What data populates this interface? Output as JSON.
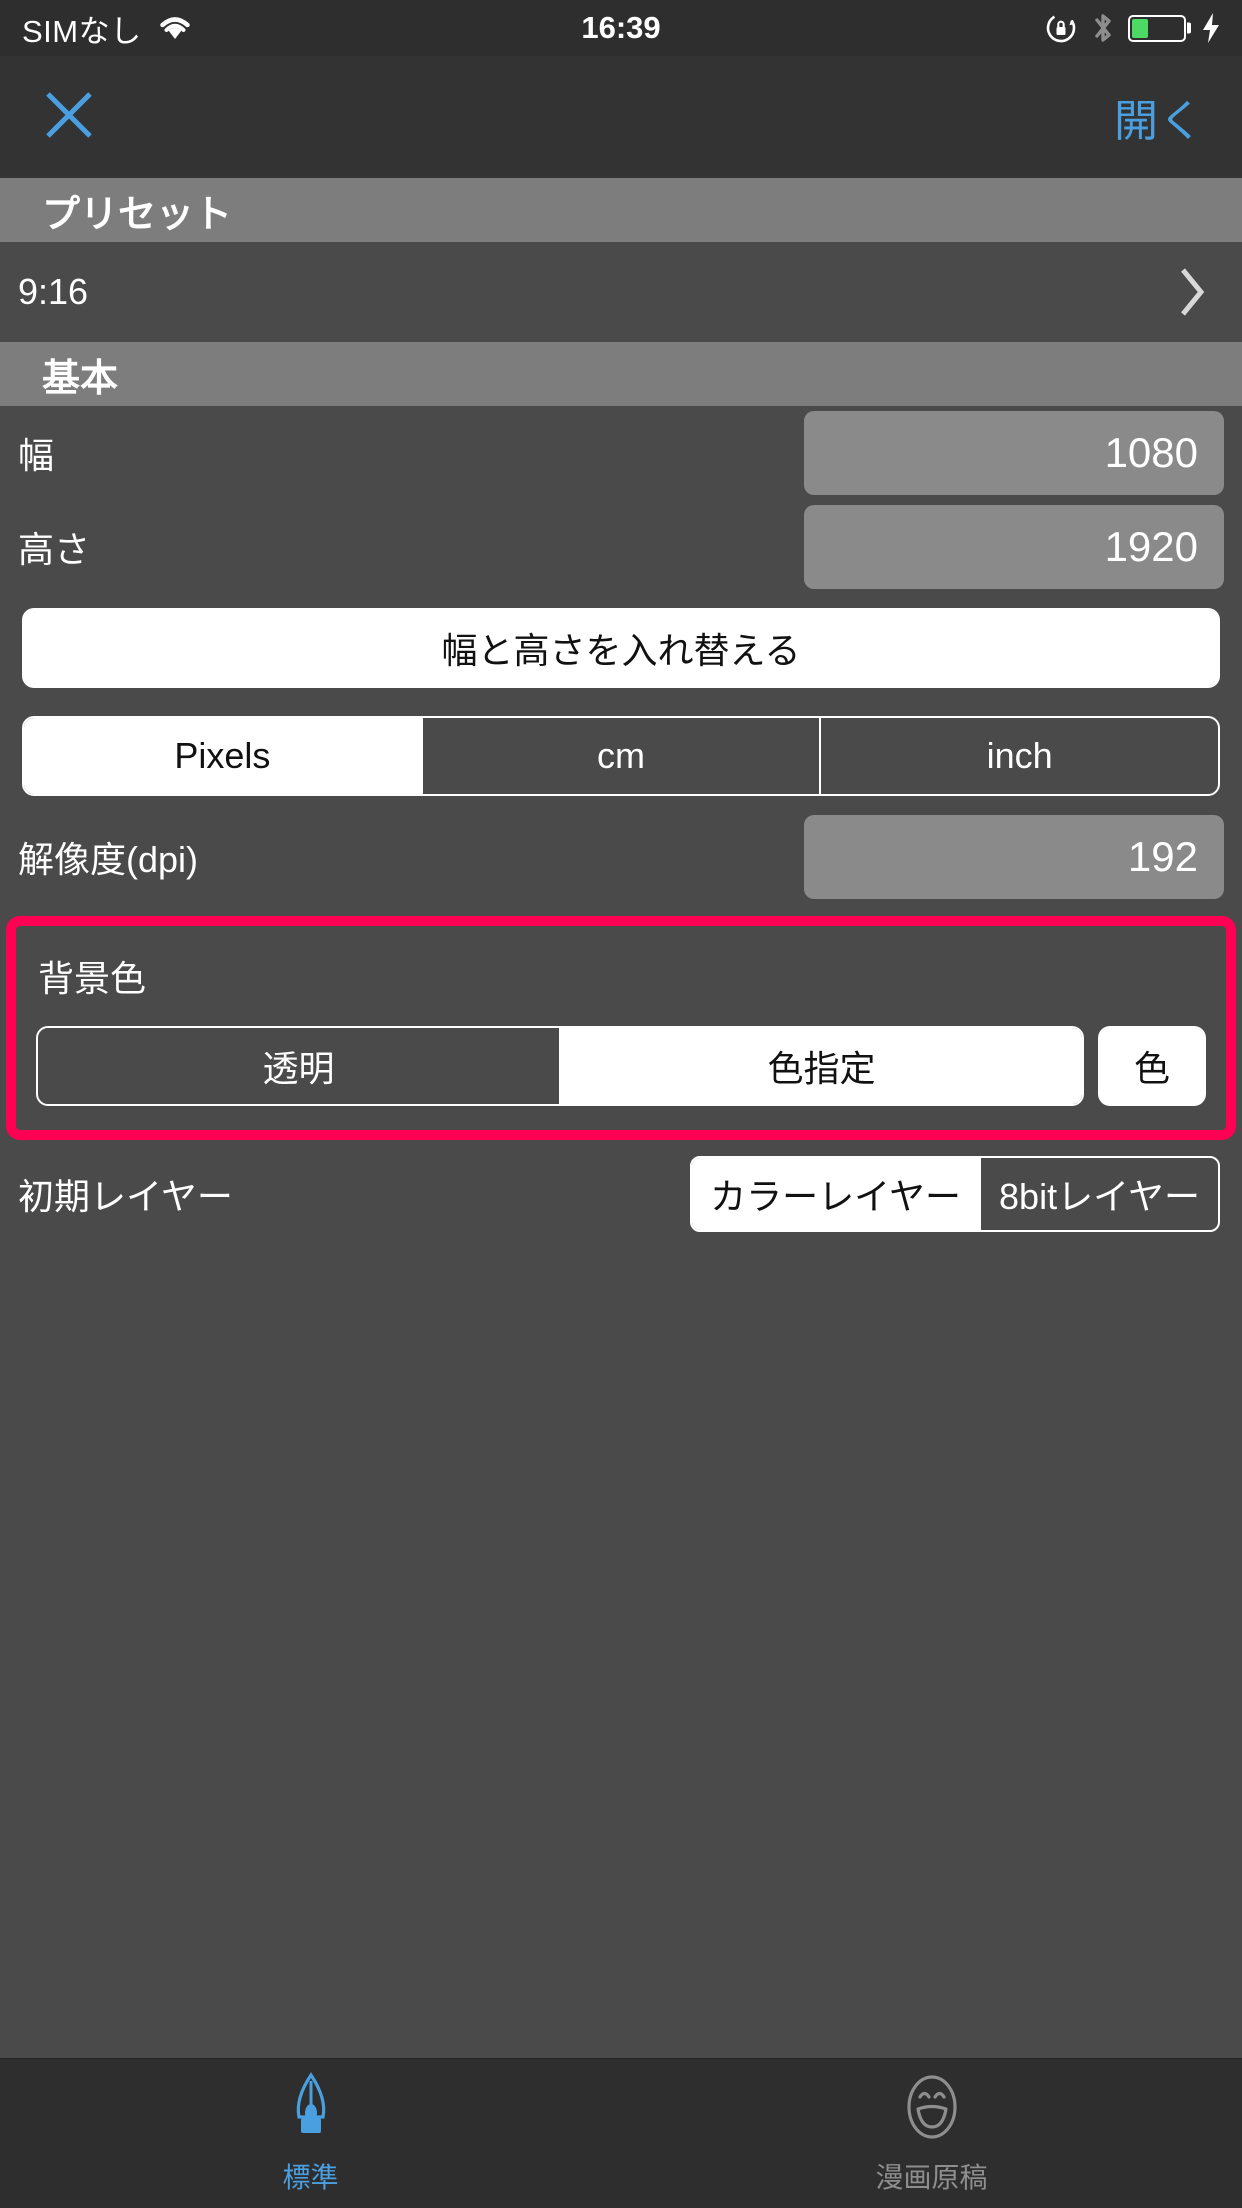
{
  "statusbar": {
    "carrier": "SIMなし",
    "time": "16:39",
    "wifi_icon": "wifi-icon",
    "rotation_lock_icon": "rotation-lock-icon",
    "bluetooth_icon": "bluetooth-icon",
    "battery_icon": "battery-icon",
    "battery_level_percent": 32,
    "charging_icon": "lightning-bolt-icon",
    "battery_color": "#4cd964"
  },
  "navbar": {
    "close_icon": "close-x-icon",
    "open_label": "開く",
    "accent_color": "#4a9fe0"
  },
  "sections": {
    "preset": {
      "header": "プリセット",
      "row_label": "9:16",
      "chevron_icon": "chevron-right-icon"
    },
    "basic": {
      "header": "基本",
      "width": {
        "label": "幅",
        "value": "1080"
      },
      "height": {
        "label": "高さ",
        "value": "1920"
      },
      "swap_button": "幅と高さを入れ替える",
      "units": {
        "options": [
          "Pixels",
          "cm",
          "inch"
        ],
        "selected": "Pixels"
      },
      "dpi": {
        "label": "解像度(dpi)",
        "value": "192"
      }
    },
    "background_color": {
      "label": "背景色",
      "options": [
        "透明",
        "色指定"
      ],
      "selected": "色指定",
      "color_button": "色",
      "highlight_color": "#ff0055"
    },
    "initial_layer": {
      "label": "初期レイヤー",
      "options": [
        "カラーレイヤー",
        "8bitレイヤー"
      ],
      "selected": "カラーレイヤー"
    }
  },
  "tabbar": {
    "tabs": [
      {
        "label": "標準",
        "icon": "pen-nib-icon",
        "active": true
      },
      {
        "label": "漫画原稿",
        "icon": "smiley-face-icon",
        "active": false
      }
    ]
  }
}
